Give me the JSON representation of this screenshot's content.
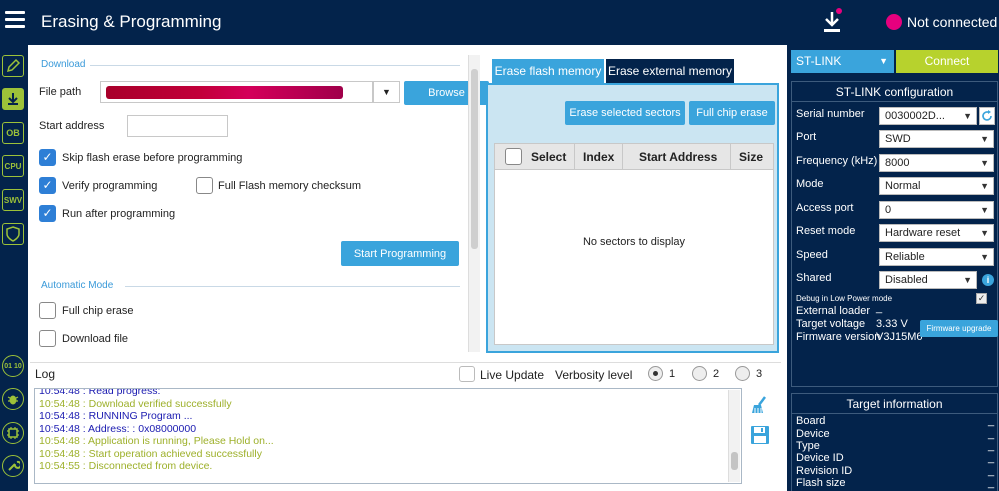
{
  "header": {
    "title": "Erasing & Programming",
    "connection_status": "Not connected",
    "colors": {
      "bar": "#03234b",
      "status_dot": "#e6007e"
    }
  },
  "sidebar": {
    "icons": [
      "edit-icon",
      "download-icon",
      "OB",
      "CPU",
      "SWV",
      "shield-icon",
      "01 10",
      "bug-icon",
      "chip-icon",
      "wrench-icon"
    ]
  },
  "download": {
    "section_title": "Download",
    "file_path_label": "File path",
    "browse_label": "Browse",
    "start_address_label": "Start address",
    "start_address_value": "",
    "skip_erase_label": "Skip flash erase before programming",
    "verify_label": "Verify programming",
    "full_checksum_label": "Full Flash memory checksum",
    "run_after_label": "Run after programming",
    "start_programming_label": "Start Programming"
  },
  "automatic_mode": {
    "section_title": "Automatic Mode",
    "full_chip_erase_label": "Full chip erase",
    "download_file_label": "Download file"
  },
  "erase": {
    "tabs": [
      "Erase flash memory",
      "Erase external memory"
    ],
    "erase_selected_label": "Erase selected sectors",
    "full_chip_erase_label": "Full chip erase",
    "columns": [
      "Select",
      "Index",
      "Start Address",
      "Size"
    ],
    "empty_message": "No sectors to display"
  },
  "log": {
    "title": "Log",
    "live_update_label": "Live Update",
    "verbosity_label": "Verbosity level",
    "verbosity_options": [
      "1",
      "2",
      "3"
    ],
    "lines": [
      {
        "text": "10:54:48 : Read progress:",
        "color": "#1a1ab0"
      },
      {
        "text": "10:54:48 : Download verified successfully",
        "color": "#9db02a"
      },
      {
        "text": "10:54:48 : RUNNING Program ...",
        "color": "#1a1ab0"
      },
      {
        "text": "10:54:48 :   Address:      : 0x08000000",
        "color": "#1a1ab0"
      },
      {
        "text": "10:54:48 : Application is running, Please Hold on...",
        "color": "#9db02a"
      },
      {
        "text": "10:54:48 : Start operation achieved successfully",
        "color": "#9db02a"
      },
      {
        "text": "10:54:55 : Disconnected from device.",
        "color": "#9db02a"
      }
    ]
  },
  "connect": {
    "interface": "ST-LINK",
    "connect_label": "Connect",
    "colors": {
      "interface_bg": "#3aa4dc",
      "connect_bg": "#b7d22d"
    }
  },
  "stlink_config": {
    "title": "ST-LINK configuration",
    "serial_number_label": "Serial number",
    "serial_number_value": "0030002D...",
    "port_label": "Port",
    "port_value": "SWD",
    "frequency_label": "Frequency (kHz)",
    "frequency_value": "8000",
    "mode_label": "Mode",
    "mode_value": "Normal",
    "access_port_label": "Access port",
    "access_port_value": "0",
    "reset_mode_label": "Reset mode",
    "reset_mode_value": "Hardware reset",
    "speed_label": "Speed",
    "speed_value": "Reliable",
    "shared_label": "Shared",
    "shared_value": "Disabled",
    "debug_low_power_label": "Debug in Low Power mode",
    "external_loader_label": "External loader",
    "external_loader_value": "_",
    "target_voltage_label": "Target voltage",
    "target_voltage_value": "3.33 V",
    "firmware_version_label": "Firmware version",
    "firmware_version_value": "V3J15M6",
    "firmware_upgrade_label": "Firmware upgrade"
  },
  "target_info": {
    "title": "Target information",
    "fields": [
      {
        "label": "Board",
        "value": "_"
      },
      {
        "label": "Device",
        "value": "_"
      },
      {
        "label": "Type",
        "value": "_"
      },
      {
        "label": "Device ID",
        "value": "_"
      },
      {
        "label": "Revision ID",
        "value": "_"
      },
      {
        "label": "Flash size",
        "value": "_"
      }
    ]
  }
}
